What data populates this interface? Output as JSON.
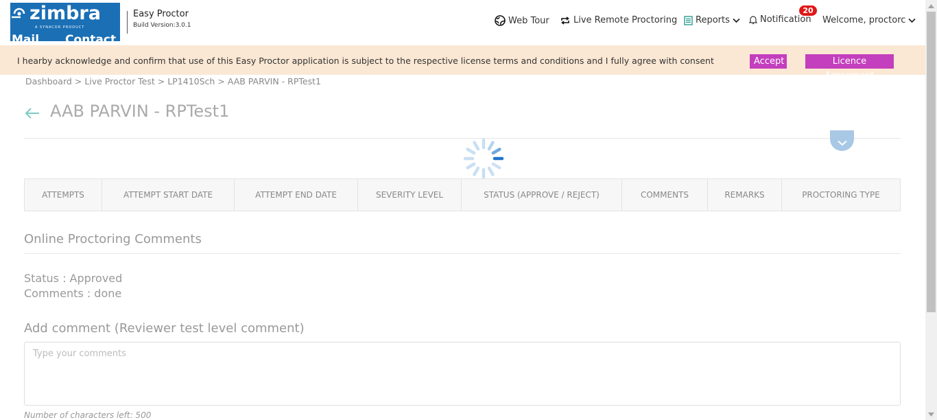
{
  "header": {
    "logo_text": "zimbra",
    "logo_tagline": "A SYNACOR PRODUCT",
    "logo_strip_items": [
      "Mail",
      "Contact"
    ],
    "app_name": "Easy Proctor",
    "build_version": "Build  Version:3.0.1",
    "nav": {
      "web_tour": "Web Tour",
      "live_remote": "Live Remote Proctoring",
      "reports": "Reports",
      "notification": "Notification",
      "notification_count": "20",
      "welcome": "Welcome, proctorc"
    }
  },
  "consent": {
    "text": "I hearby acknowledge and confirm that use of this Easy Proctor application is subject to the respective license terms and conditions and I fully agree with consent",
    "accept_label": "Accept",
    "licence_label": "Licence Agreement"
  },
  "breadcrumb": [
    "Dashboard",
    "Live Proctor Test",
    "LP1410Sch",
    "AAB PARVIN - RPTest1"
  ],
  "breadcrumb_separator": ">",
  "page_title": "AAB PARVIN - RPTest1",
  "table": {
    "columns": [
      "ATTEMPTS",
      "ATTEMPT START DATE",
      "ATTEMPT END DATE",
      "SEVERITY LEVEL",
      "STATUS (APPROVE / REJECT)",
      "COMMENTS",
      "REMARKS",
      "PROCTORING TYPE"
    ]
  },
  "online_comments": {
    "title": "Online Proctoring Comments",
    "status": "Status : Approved",
    "comments": "Comments : done"
  },
  "add_comment": {
    "title": "Add comment (Reviewer test level comment)",
    "placeholder": "Type your comments",
    "chars_left": "Number of characters left: 500"
  },
  "colors": {
    "brand_blue": "#1a6fb5",
    "consent_bg": "#fbe8d4",
    "button_magenta": "#c33fbd",
    "badge_red": "#e01818",
    "back_arrow": "#7ccbc6"
  }
}
